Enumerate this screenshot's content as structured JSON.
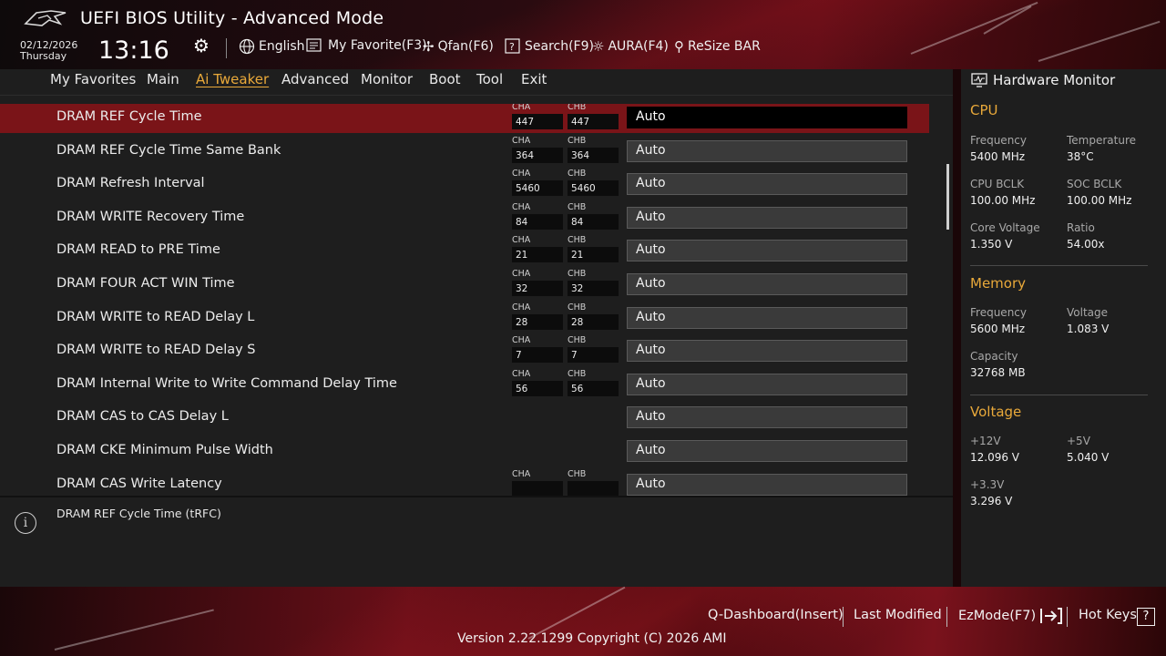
{
  "header": {
    "title": "UEFI BIOS Utility - Advanced Mode",
    "date": "02/12/2026",
    "day": "Thursday",
    "time": "13:16",
    "tools": {
      "language": "English",
      "favorite": "My Favorite(F3)",
      "qfan": "Qfan(F6)",
      "search": "Search(F9)",
      "aura": "AURA(F4)",
      "resize": "ReSize BAR"
    }
  },
  "tabs": [
    "My Favorites",
    "Main",
    "Ai Tweaker",
    "Advanced",
    "Monitor",
    "Boot",
    "Tool",
    "Exit"
  ],
  "active_tab": "Ai Tweaker",
  "rows": [
    {
      "label": "DRAM REF Cycle Time",
      "cha_cap": "CHA",
      "chb_cap": "CHB",
      "cha": "447",
      "chb": "447",
      "value": "Auto",
      "selected": true
    },
    {
      "label": "DRAM REF Cycle Time Same Bank",
      "cha_cap": "CHA",
      "chb_cap": "CHB",
      "cha": "364",
      "chb": "364",
      "value": "Auto"
    },
    {
      "label": "DRAM Refresh Interval",
      "cha_cap": "CHA",
      "chb_cap": "CHB",
      "cha": "5460",
      "chb": "5460",
      "value": "Auto"
    },
    {
      "label": "DRAM WRITE Recovery Time",
      "cha_cap": "CHA",
      "chb_cap": "CHB",
      "cha": "84",
      "chb": "84",
      "value": "Auto"
    },
    {
      "label": "DRAM READ to PRE Time",
      "cha_cap": "CHA",
      "chb_cap": "CHB",
      "cha": "21",
      "chb": "21",
      "value": "Auto"
    },
    {
      "label": "DRAM FOUR ACT WIN Time",
      "cha_cap": "CHA",
      "chb_cap": "CHB",
      "cha": "32",
      "chb": "32",
      "value": "Auto"
    },
    {
      "label": "DRAM WRITE to READ Delay L",
      "cha_cap": "CHA",
      "chb_cap": "CHB",
      "cha": "28",
      "chb": "28",
      "value": "Auto"
    },
    {
      "label": "DRAM WRITE to READ Delay S",
      "cha_cap": "CHA",
      "chb_cap": "CHB",
      "cha": "7",
      "chb": "7",
      "value": "Auto"
    },
    {
      "label": "DRAM Internal Write to Write Command Delay Time",
      "cha_cap": "CHA",
      "chb_cap": "CHB",
      "cha": "56",
      "chb": "56",
      "value": "Auto"
    },
    {
      "label": "DRAM CAS to CAS Delay L",
      "value": "Auto"
    },
    {
      "label": "DRAM CKE Minimum Pulse Width",
      "value": "Auto"
    },
    {
      "label": "DRAM CAS Write Latency",
      "cha_cap": "CHA",
      "chb_cap": "CHB",
      "cha": "",
      "chb": "",
      "value": "Auto"
    }
  ],
  "help": {
    "text": "DRAM REF Cycle Time (tRFC)"
  },
  "hardware_monitor": {
    "title": "Hardware Monitor",
    "cpu": {
      "heading": "CPU",
      "frequency_label": "Frequency",
      "frequency": "5400 MHz",
      "temperature_label": "Temperature",
      "temperature": "38°C",
      "cpu_bclk_label": "CPU BCLK",
      "cpu_bclk": "100.00 MHz",
      "soc_bclk_label": "SOC BCLK",
      "soc_bclk": "100.00 MHz",
      "core_voltage_label": "Core Voltage",
      "core_voltage": "1.350 V",
      "ratio_label": "Ratio",
      "ratio": "54.00x"
    },
    "memory": {
      "heading": "Memory",
      "frequency_label": "Frequency",
      "frequency": "5600 MHz",
      "voltage_label": "Voltage",
      "voltage": "1.083 V",
      "capacity_label": "Capacity",
      "capacity": "32768 MB"
    },
    "voltage": {
      "heading": "Voltage",
      "v12_label": "+12V",
      "v12": "12.096 V",
      "v5_label": "+5V",
      "v5": "5.040 V",
      "v33_label": "+3.3V",
      "v33": "3.296 V"
    }
  },
  "footer": {
    "qdashboard": "Q-Dashboard(Insert)",
    "last_modified": "Last Modified",
    "ezmode": "EzMode(F7)",
    "hotkeys": "Hot Keys",
    "hotkeys_key": "?",
    "version": "Version 2.22.1299 Copyright (C) 2026 AMI"
  },
  "colors": {
    "accent": "#e9a93a",
    "selected_row": "#7a1418",
    "panel": "#1e1e1e"
  }
}
